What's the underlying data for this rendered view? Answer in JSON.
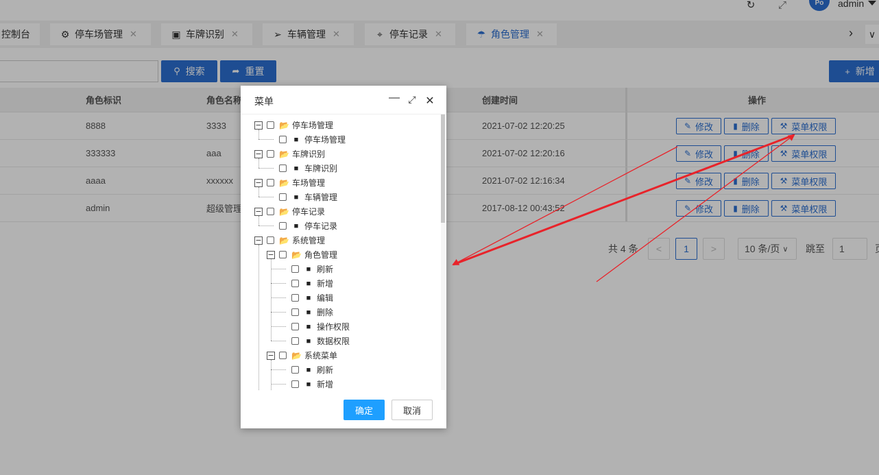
{
  "header": {
    "refresh_icon": "refresh-icon",
    "fullscreen_icon": "fullscreen-icon",
    "avatar_text": "Po",
    "user_name": "admin"
  },
  "tabs": [
    {
      "label": "控制台",
      "icon": "home-icon",
      "closable": false
    },
    {
      "label": "停车场管理",
      "icon": "gear-icon",
      "closable": true
    },
    {
      "label": "车牌识别",
      "icon": "camera-icon",
      "closable": true
    },
    {
      "label": "车辆管理",
      "icon": "send-icon",
      "closable": true
    },
    {
      "label": "停车记录",
      "icon": "location-icon",
      "closable": true
    },
    {
      "label": "角色管理",
      "icon": "pin-icon",
      "closable": true,
      "active": true
    }
  ],
  "toolbar": {
    "search_placeholder": "",
    "search_label": "搜索",
    "reset_label": "重置",
    "add_label": "新增"
  },
  "table": {
    "columns": [
      "角色标识",
      "角色名称",
      "创建时间",
      "操作"
    ],
    "rows": [
      {
        "key": "8888",
        "name": "3333",
        "created": "2021-07-02 12:20:25"
      },
      {
        "key": "333333",
        "name": "aaa",
        "created": "2021-07-02 12:20:16"
      },
      {
        "key": "aaaa",
        "name": "xxxxxx",
        "created": "2021-07-02 12:16:34"
      },
      {
        "key": "admin",
        "name": "超级管理员",
        "created": "2017-08-12 00:43:52"
      }
    ],
    "actions": {
      "edit": "修改",
      "delete": "删除",
      "menu_perm": "菜单权限"
    }
  },
  "pagination": {
    "total_text": "共 4 条",
    "current_page": "1",
    "prev": "<",
    "next": ">",
    "page_size": "10 条/页",
    "jump_label": "跳至",
    "jump_value": "1",
    "page_suffix": "页"
  },
  "dialog": {
    "title": "菜单",
    "ok_label": "确定",
    "cancel_label": "取消",
    "scroll_position": 0,
    "tree": [
      {
        "label": "停车场管理",
        "level": 0,
        "type": "folder"
      },
      {
        "label": "停车场管理",
        "level": 1,
        "type": "leaf"
      },
      {
        "label": "车牌识别",
        "level": 0,
        "type": "folder"
      },
      {
        "label": "车牌识别",
        "level": 1,
        "type": "leaf"
      },
      {
        "label": "车场管理",
        "level": 0,
        "type": "folder"
      },
      {
        "label": "车辆管理",
        "level": 1,
        "type": "leaf"
      },
      {
        "label": "停车记录",
        "level": 0,
        "type": "folder"
      },
      {
        "label": "停车记录",
        "level": 1,
        "type": "leaf"
      },
      {
        "label": "系统管理",
        "level": 0,
        "type": "folder"
      },
      {
        "label": "角色管理",
        "level": 1,
        "type": "folder"
      },
      {
        "label": "刷新",
        "level": 2,
        "type": "leaf"
      },
      {
        "label": "新增",
        "level": 2,
        "type": "leaf"
      },
      {
        "label": "编辑",
        "level": 2,
        "type": "leaf"
      },
      {
        "label": "删除",
        "level": 2,
        "type": "leaf"
      },
      {
        "label": "操作权限",
        "level": 2,
        "type": "leaf"
      },
      {
        "label": "数据权限",
        "level": 2,
        "type": "leaf"
      },
      {
        "label": "系统菜单",
        "level": 1,
        "type": "folder"
      },
      {
        "label": "刷新",
        "level": 2,
        "type": "leaf"
      },
      {
        "label": "新增",
        "level": 2,
        "type": "leaf"
      }
    ]
  },
  "colors": {
    "primary": "#2b6fd1",
    "dialog_ok": "#1e9fff",
    "annotation_arrow": "#e8232a"
  }
}
